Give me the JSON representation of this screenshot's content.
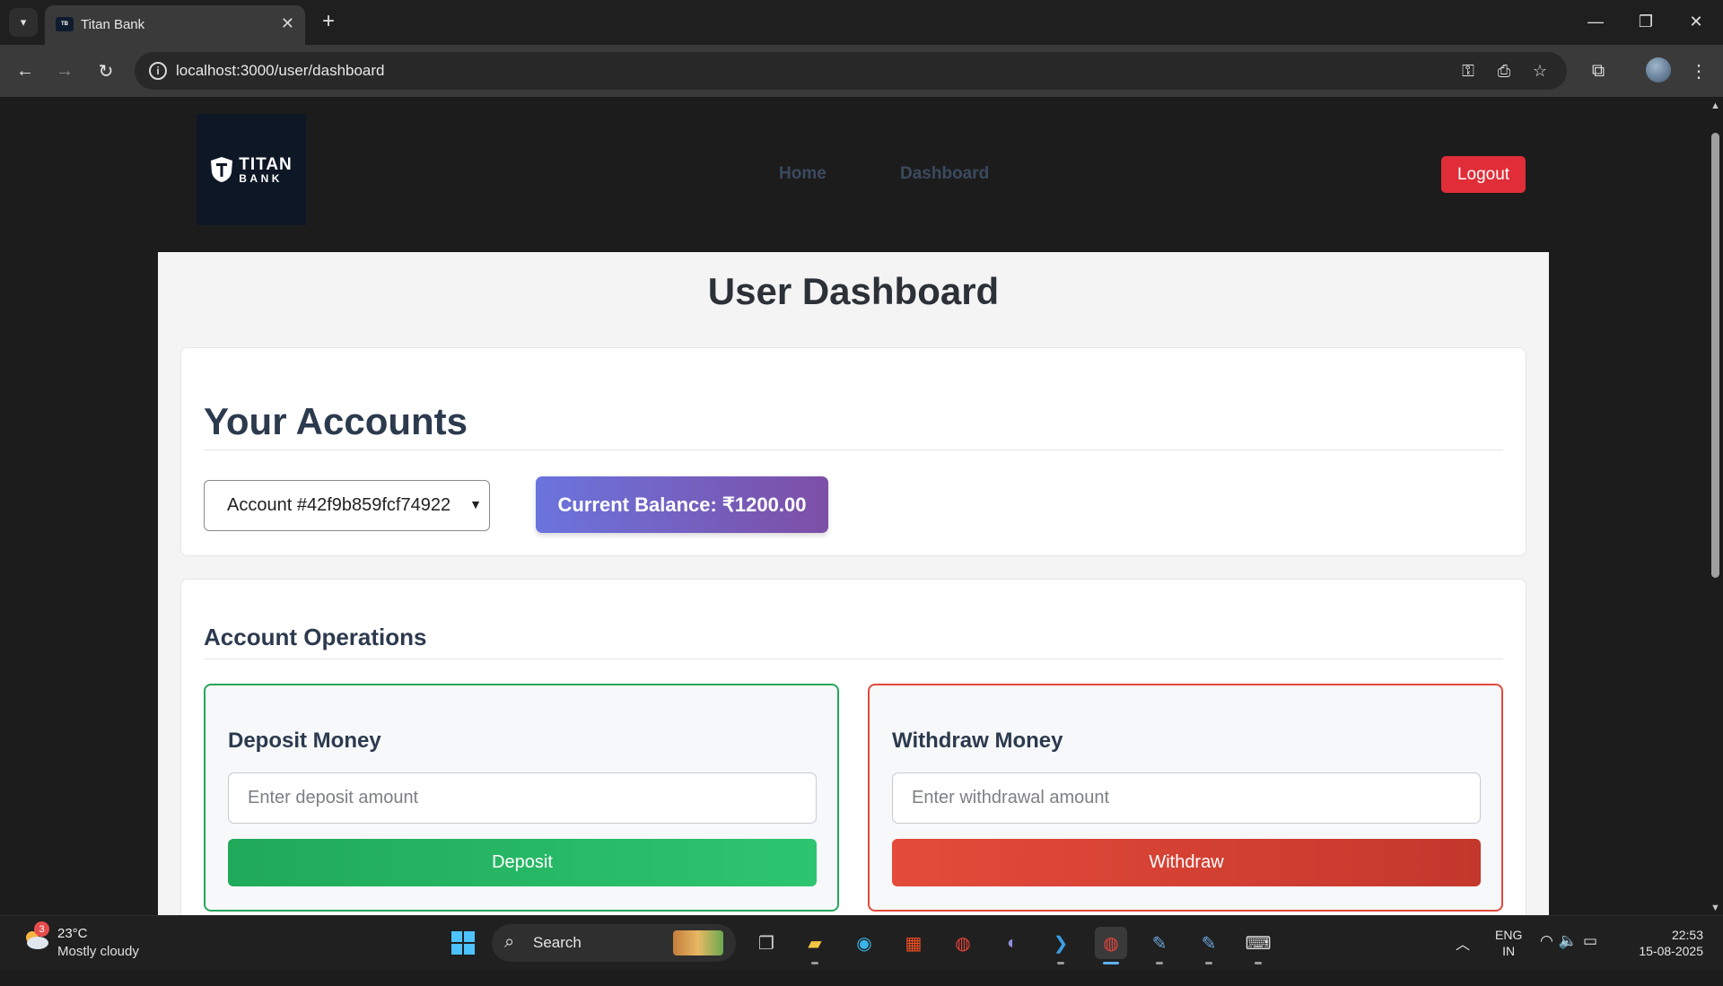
{
  "browser": {
    "tab_title": "Titan Bank",
    "url": "localhost:3000/user/dashboard"
  },
  "site": {
    "logo_line1": "TITAN",
    "logo_line2": "BANK",
    "nav": [
      {
        "label": "Home"
      },
      {
        "label": "Dashboard"
      }
    ],
    "logout_label": "Logout"
  },
  "dashboard": {
    "title": "User Dashboard",
    "accounts_heading": "Your Accounts",
    "selected_account": "Account #42f9b859fcf74922",
    "balance_text": "Current Balance: ₹1200.00",
    "operations_heading": "Account Operations",
    "deposit": {
      "title": "Deposit Money",
      "placeholder": "Enter deposit amount",
      "button_label": "Deposit",
      "accent": "#26a65a"
    },
    "withdraw": {
      "title": "Withdraw Money",
      "placeholder": "Enter withdrawal amount",
      "button_label": "Withdraw",
      "accent": "#e24a3c"
    }
  },
  "taskbar": {
    "weather_badge": "3",
    "weather_temp": "23°C",
    "weather_desc": "Mostly cloudy",
    "search_label": "Search",
    "lang_line1": "ENG",
    "lang_line2": "IN",
    "time": "22:53",
    "date": "15-08-2025"
  },
  "colors": {
    "logout": "#e02d38",
    "balance_gradient_start": "#6b74dd",
    "balance_gradient_end": "#7d4fa6"
  }
}
